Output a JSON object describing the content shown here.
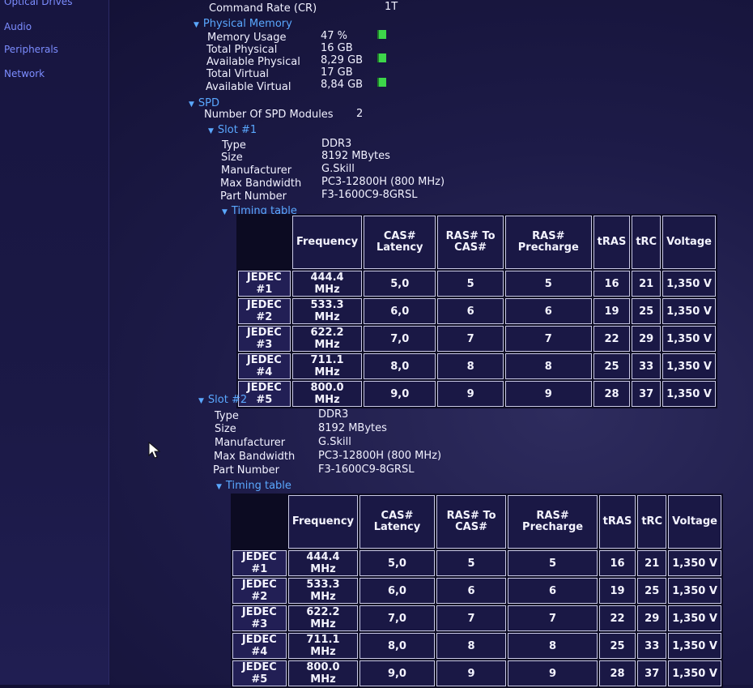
{
  "sidebar": {
    "items": [
      "Optical Drives",
      "Audio",
      "Peripherals",
      "Network"
    ]
  },
  "cpu_tail": {
    "command_rate_label": "Command Rate (CR)",
    "command_rate_value": "1T"
  },
  "physical_memory": {
    "title": "Physical Memory",
    "rows": [
      {
        "label": "Memory Usage",
        "value": "47 %"
      },
      {
        "label": "Total Physical",
        "value": "16 GB"
      },
      {
        "label": "Available Physical",
        "value": "8,29 GB"
      },
      {
        "label": "Total Virtual",
        "value": "17 GB"
      },
      {
        "label": "Available Virtual",
        "value": "8,84 GB"
      }
    ]
  },
  "spd": {
    "title": "SPD",
    "modules_label": "Number Of SPD Modules",
    "modules_value": "2",
    "slots": [
      {
        "title": "Slot #1",
        "fields": [
          {
            "label": "Type",
            "value": "DDR3"
          },
          {
            "label": "Size",
            "value": "8192 MBytes"
          },
          {
            "label": "Manufacturer",
            "value": "G.Skill"
          },
          {
            "label": "Max Bandwidth",
            "value": "PC3-12800H (800 MHz)"
          },
          {
            "label": "Part Number",
            "value": "F3-1600C9-8GRSL"
          }
        ],
        "timing_title": "Timing table"
      },
      {
        "title": "Slot #2",
        "fields": [
          {
            "label": "Type",
            "value": "DDR3"
          },
          {
            "label": "Size",
            "value": "8192 MBytes"
          },
          {
            "label": "Manufacturer",
            "value": "G.Skill"
          },
          {
            "label": "Max Bandwidth",
            "value": "PC3-12800H (800 MHz)"
          },
          {
            "label": "Part Number",
            "value": "F3-1600C9-8GRSL"
          }
        ],
        "timing_title": "Timing table"
      }
    ],
    "timing_headers": [
      "Frequency",
      "CAS# Latency",
      "RAS# To CAS#",
      "RAS# Precharge",
      "tRAS",
      "tRC",
      "Voltage"
    ],
    "timing_rows": [
      [
        "JEDEC #1",
        "444.4 MHz",
        "5,0",
        "5",
        "5",
        "16",
        "21",
        "1,350 V"
      ],
      [
        "JEDEC #2",
        "533.3 MHz",
        "6,0",
        "6",
        "6",
        "19",
        "25",
        "1,350 V"
      ],
      [
        "JEDEC #3",
        "622.2 MHz",
        "7,0",
        "7",
        "7",
        "22",
        "29",
        "1,350 V"
      ],
      [
        "JEDEC #4",
        "711.1 MHz",
        "8,0",
        "8",
        "8",
        "25",
        "33",
        "1,350 V"
      ],
      [
        "JEDEC #5",
        "800.0 MHz",
        "9,0",
        "9",
        "9",
        "28",
        "37",
        "1,350 V"
      ]
    ]
  },
  "colors": {
    "accent": "#5aa8ff",
    "bar": "#3dd64a",
    "background": "#1d1b48"
  },
  "icons": {
    "expand": "triangle-down-icon",
    "usage_bar": "usage-bar-icon",
    "cursor": "mouse-pointer-icon"
  }
}
